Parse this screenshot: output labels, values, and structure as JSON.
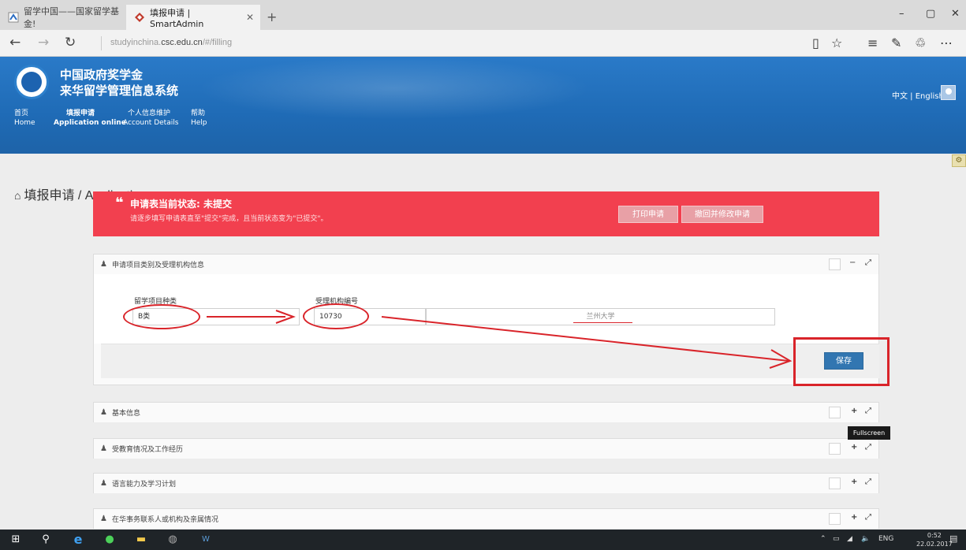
{
  "browser": {
    "tabs": [
      {
        "label": "留学中国——国家留学基金!",
        "active": false
      },
      {
        "label": "填报申请 | SmartAdmin",
        "active": true
      }
    ],
    "new_tab_glyph": "+",
    "url_prefix": "studyinchina.",
    "url_domain": "csc.edu.cn",
    "url_path": "/#/filling",
    "window_controls": [
      "–",
      "▢",
      "✕"
    ]
  },
  "app": {
    "brand_line1": "中国政府奖学金",
    "brand_line2": "来华留学管理信息系统",
    "lang_switch": "中文 | English",
    "menu": [
      {
        "cn": "首页",
        "en": "Home",
        "active": false
      },
      {
        "cn": "填报申请",
        "en": "Application online",
        "active": true
      },
      {
        "cn": "个人信息维护",
        "en": "Account Details",
        "active": false
      },
      {
        "cn": "帮助",
        "en": "Help",
        "active": false
      }
    ]
  },
  "page": {
    "title": "填报申请 / Application"
  },
  "banner": {
    "quote_mark": "❝",
    "status": "申请表当前状态: 未提交",
    "hint": "请逐步填写申请表直至\"提交\"完成，且当前状态变为\"已提交\"。",
    "print_button": "打印申请",
    "withdraw_button": "撤回并修改申请",
    "color": "#f2404f"
  },
  "form_panel": {
    "title": "申请项目类别及受理机构信息",
    "program_type_label": "留学项目种类",
    "program_type_value": "B类",
    "institution_code_label": "受理机构编号",
    "institution_code_value": "10730",
    "institution_name": "兰州大学",
    "save_button": "保存",
    "minimize_glyph": "−",
    "fullscreen_glyph": "⤢"
  },
  "sections": [
    {
      "title": "基本信息"
    },
    {
      "title": "受教育情况及工作经历"
    },
    {
      "title": "语言能力及学习计划"
    },
    {
      "title": "在华事务联系人或机构及亲属情况"
    }
  ],
  "expand_glyph": "+",
  "tooltip": "Fullscreen",
  "taskbar": {
    "lang": "ENG",
    "time": "0:52",
    "date": "22.02.2017"
  },
  "colors": {
    "header_blue": "#1f6bb6",
    "annotation_red": "#d9242a",
    "save_blue": "#3276b1"
  }
}
